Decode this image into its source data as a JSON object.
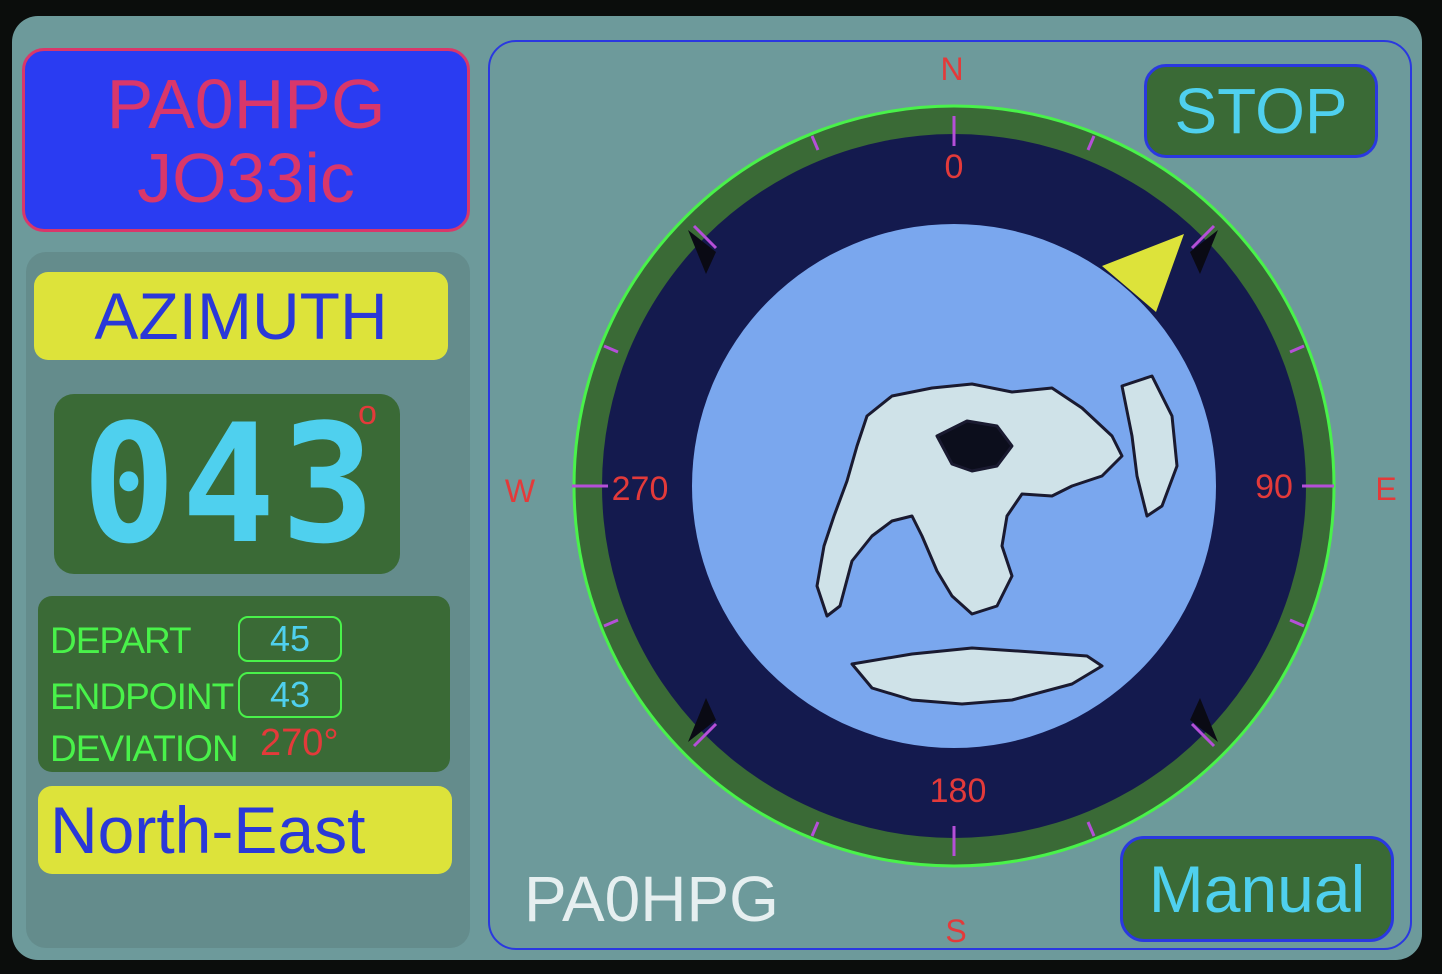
{
  "header": {
    "callsign": "PA0HPG",
    "locator": "JO33ic"
  },
  "azimuth": {
    "label": "AZIMUTH",
    "value": "043",
    "degree_symbol": "o",
    "heading_deg": 43
  },
  "stats": {
    "depart_label": "DEPART",
    "depart_value": "45",
    "endpoint_label": "ENDPOINT",
    "endpoint_value": "43",
    "deviation_label": "DEVIATION",
    "deviation_value": "270°"
  },
  "direction": "North-East",
  "buttons": {
    "stop": "STOP",
    "manual": "Manual"
  },
  "footer_callsign": "PA0HPG",
  "compass": {
    "n": "N",
    "e": "E",
    "s": "S",
    "w": "W",
    "deg_0": "0",
    "deg_90": "90",
    "deg_180": "180",
    "deg_270": "270"
  },
  "colors": {
    "background": "#6d9a9b",
    "accent_yellow": "#dde33a",
    "panel_green": "#3a6a36",
    "text_cyan": "#4fd0ee",
    "text_red": "#e33a3a",
    "header_blue": "#2a3cf2"
  }
}
